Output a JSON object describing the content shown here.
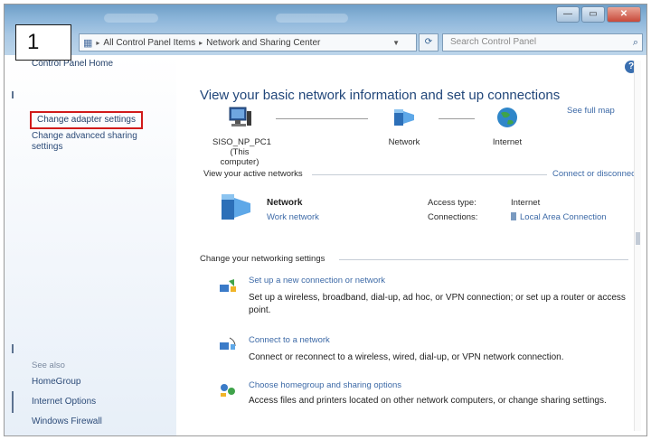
{
  "step_number": "1",
  "window": {
    "controls": {
      "minimize": "—",
      "maximize": "▭",
      "close": "✕"
    }
  },
  "address_bar": {
    "segments": [
      "All Control Panel Items",
      "Network and Sharing Center"
    ],
    "search_placeholder": "Search Control Panel"
  },
  "sidebar": {
    "home": "Control Panel Home",
    "links": [
      "Change adapter settings",
      "Change advanced sharing settings"
    ],
    "see_also_label": "See also",
    "see_also": [
      "HomeGroup",
      "Internet Options",
      "Windows Firewall"
    ]
  },
  "main": {
    "title": "View your basic network information and set up connections",
    "see_full_map": "See full map",
    "map": {
      "computer_name": "SISO_NP_PC1",
      "computer_sub": "(This computer)",
      "network": "Network",
      "internet": "Internet"
    },
    "active_networks": {
      "label": "View your active networks",
      "connect_link": "Connect or disconnect",
      "network_name": "Network",
      "network_type": "Work network",
      "access_type_label": "Access type:",
      "access_type_value": "Internet",
      "connections_label": "Connections:",
      "connections_value": "Local Area Connection"
    },
    "change_settings": {
      "label": "Change your networking settings",
      "tasks": [
        {
          "link": "Set up a new connection or network",
          "desc": "Set up a wireless, broadband, dial-up, ad hoc, or VPN connection; or set up a router or access point."
        },
        {
          "link": "Connect to a network",
          "desc": "Connect or reconnect to a wireless, wired, dial-up, or VPN network connection."
        },
        {
          "link": "Choose homegroup and sharing options",
          "desc": "Access files and printers located on other network computers, or change sharing settings."
        }
      ]
    }
  },
  "colors": {
    "link": "#3d6aa7",
    "highlight_box": "#d11a1a",
    "title": "#22477a"
  }
}
